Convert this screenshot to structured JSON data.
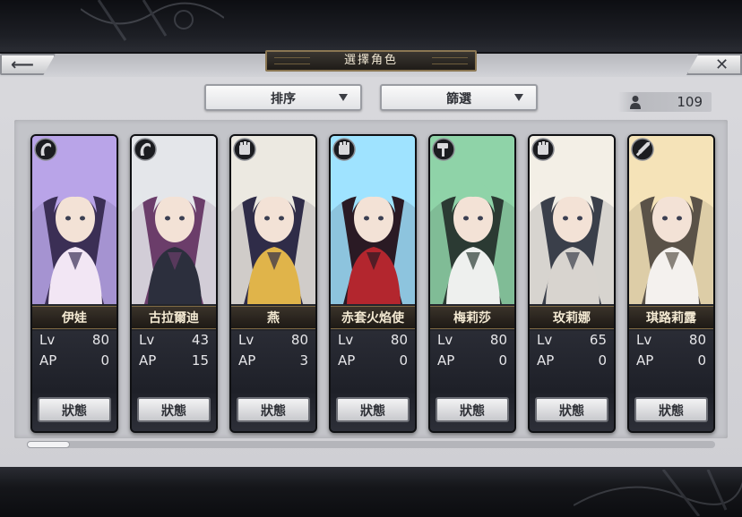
{
  "header": {
    "title": "選擇角色",
    "back_icon": "back-arrow-icon",
    "close_icon": "close-icon"
  },
  "toolbar": {
    "sort_label": "排序",
    "filter_label": "篩選",
    "character_count": "109"
  },
  "characters": [
    {
      "name": "伊娃",
      "lv_label": "Lv",
      "lv": "80",
      "ap_label": "AP",
      "ap": "0",
      "status_label": "狀態",
      "type_icon": "horn-icon",
      "palette": [
        "#b9a4e8",
        "#f2e6f4",
        "#3b2f55"
      ]
    },
    {
      "name": "古拉爾迪",
      "lv_label": "Lv",
      "lv": "43",
      "ap_label": "AP",
      "ap": "15",
      "status_label": "狀態",
      "type_icon": "horn-icon",
      "palette": [
        "#e4e6ea",
        "#2c2f3d",
        "#6b3d6a"
      ]
    },
    {
      "name": "燕",
      "lv_label": "Lv",
      "lv": "80",
      "ap_label": "AP",
      "ap": "3",
      "status_label": "狀態",
      "type_icon": "gauntlet-icon",
      "palette": [
        "#ece9e1",
        "#e0b44a",
        "#2f2c48"
      ]
    },
    {
      "name": "赤套火焰使",
      "lv_label": "Lv",
      "lv": "80",
      "ap_label": "AP",
      "ap": "0",
      "status_label": "狀態",
      "type_icon": "gauntlet-icon",
      "palette": [
        "#9fe3ff",
        "#b3262e",
        "#2a1a24"
      ]
    },
    {
      "name": "梅莉莎",
      "lv_label": "Lv",
      "lv": "80",
      "ap_label": "AP",
      "ap": "0",
      "status_label": "狀態",
      "type_icon": "hammer-icon",
      "palette": [
        "#8fd3a8",
        "#eef0ee",
        "#2b3a33"
      ]
    },
    {
      "name": "玫莉娜",
      "lv_label": "Lv",
      "lv": "65",
      "ap_label": "AP",
      "ap": "0",
      "status_label": "狀態",
      "type_icon": "gauntlet-icon",
      "palette": [
        "#f3efe6",
        "#d8d4cf",
        "#3a3f4a"
      ]
    },
    {
      "name": "琪路莉露",
      "lv_label": "Lv",
      "lv": "80",
      "ap_label": "AP",
      "ap": "0",
      "status_label": "狀態",
      "type_icon": "sword-icon",
      "palette": [
        "#f5e3b8",
        "#f4f1ee",
        "#5a5248"
      ]
    }
  ],
  "scroll": {
    "position": 0
  }
}
